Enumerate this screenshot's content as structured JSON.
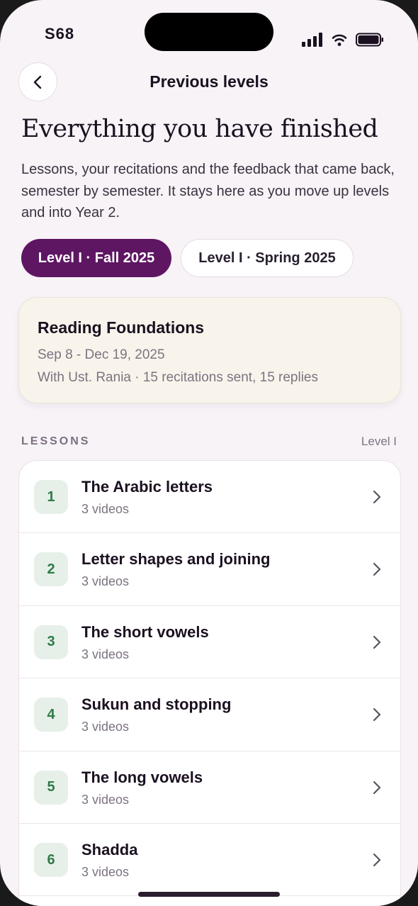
{
  "status_bar": {
    "carrier": "S68"
  },
  "header": {
    "title": "Previous levels"
  },
  "headline": "Everything you have finished",
  "intro": "Lessons, your recitations and the feedback that came back, semester by semester. It stays here as you move up levels and into Year 2.",
  "level_tabs": [
    {
      "label": "Level I · Fall 2025",
      "selected": true
    },
    {
      "label": "Level I · Spring 2025",
      "selected": false
    }
  ],
  "course": {
    "title": "Reading Foundations",
    "dates": "Sep 8 - Dec 19, 2025",
    "meta": "With Ust. Rania · 15 recitations sent, 15 replies"
  },
  "lessons_section": {
    "label": "LESSONS",
    "level": "Level I"
  },
  "lessons": [
    {
      "number": "1",
      "title": "The Arabic letters",
      "subtitle": "3 videos"
    },
    {
      "number": "2",
      "title": "Letter shapes and joining",
      "subtitle": "3 videos"
    },
    {
      "number": "3",
      "title": "The short vowels",
      "subtitle": "3 videos"
    },
    {
      "number": "4",
      "title": "Sukun and stopping",
      "subtitle": "3 videos"
    },
    {
      "number": "5",
      "title": "The long vowels",
      "subtitle": "3 videos"
    },
    {
      "number": "6",
      "title": "Shadda",
      "subtitle": "3 videos"
    }
  ],
  "colors": {
    "accent": "#5e1663",
    "background": "#f7f3f7",
    "lesson_badge_bg": "#e6f0e9",
    "lesson_badge_fg": "#2f7a47",
    "course_card_bg": "#f8f4ec"
  },
  "icons": {
    "back": "chevron-left-icon",
    "row": "chevron-right-icon",
    "signal": "cellular-signal-icon",
    "wifi": "wifi-icon",
    "battery": "battery-icon"
  }
}
